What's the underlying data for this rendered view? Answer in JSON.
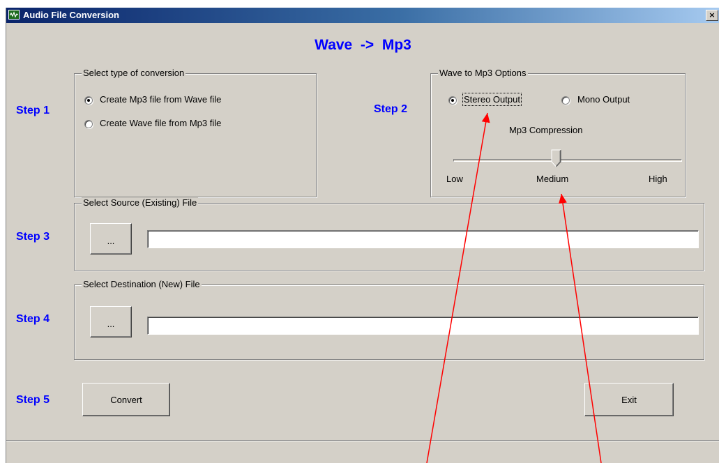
{
  "window": {
    "title": "Audio File Conversion",
    "close_label": "×"
  },
  "heading": "Wave  ->  Mp3",
  "steps": {
    "step1": "Step 1",
    "step2": "Step 2",
    "step3": "Step 3",
    "step4": "Step 4",
    "step5": "Step 5"
  },
  "conversion_type": {
    "legend": "Select type of conversion",
    "options": [
      {
        "label": "Create Mp3 file from Wave file",
        "checked": true
      },
      {
        "label": "Create Wave file from Mp3 file",
        "checked": false
      }
    ]
  },
  "mp3_options": {
    "legend": "Wave to Mp3  Options",
    "stereo_label": "Stereo Output",
    "stereo_checked": true,
    "mono_label": "Mono Output",
    "mono_checked": false,
    "compression_label": "Mp3 Compression",
    "slider_low": "Low",
    "slider_medium": "Medium",
    "slider_high": "High",
    "slider_value": "Medium"
  },
  "source": {
    "legend": "Select Source (Existing) File",
    "browse_label": "...",
    "path_value": ""
  },
  "destination": {
    "legend": "Select Destination (New) File",
    "browse_label": "...",
    "path_value": ""
  },
  "actions": {
    "convert_label": "Convert",
    "exit_label": "Exit"
  },
  "colors": {
    "step_text": "#0000ff",
    "window_bg": "#d4d0c8",
    "annotation_arrow": "#ff0000"
  }
}
